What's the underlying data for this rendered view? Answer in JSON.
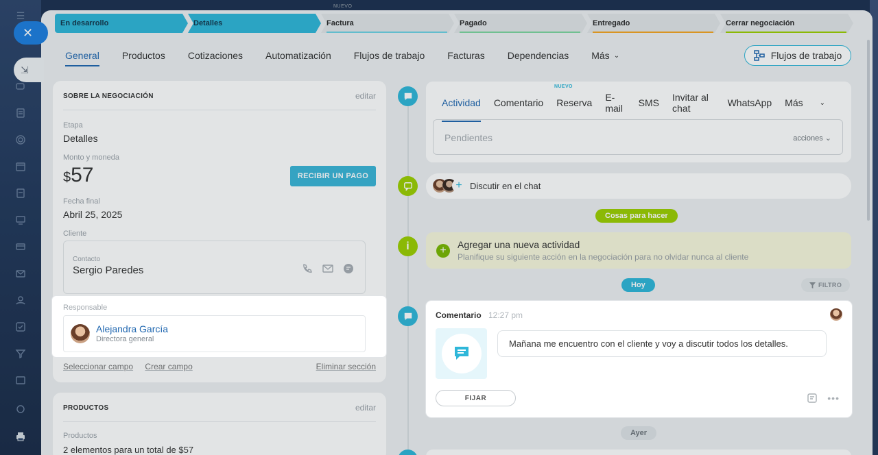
{
  "stages": [
    {
      "label": "En desarrollo",
      "state": "active",
      "color": "#2fb7d9"
    },
    {
      "label": "Detalles",
      "state": "active",
      "color": "#2fb7d9"
    },
    {
      "label": "Factura",
      "state": "pending",
      "color": "#6ed3e4"
    },
    {
      "label": "Pagado",
      "state": "pending",
      "color": "#7ed6a0"
    },
    {
      "label": "Entregado",
      "state": "pending",
      "color": "#f5a623"
    },
    {
      "label": "Cerrar negociación",
      "state": "pending",
      "color": "#9dcf00"
    }
  ],
  "stage_new_tag": "NUEVO",
  "tabs": [
    "General",
    "Productos",
    "Cotizaciones",
    "Automatización",
    "Flujos de trabajo",
    "Facturas",
    "Dependencias",
    "Más"
  ],
  "flows_button": "Flujos de trabajo",
  "about": {
    "title": "SOBRE LA NEGOCIACIÓN",
    "edit": "editar",
    "stage_label": "Etapa",
    "stage_value": "Detalles",
    "amount_label": "Monto y moneda",
    "currency": "$",
    "amount": "57",
    "pay_button": "RECIBIR UN PAGO",
    "date_label": "Fecha final",
    "date_value": "Abril 25, 2025",
    "client_label": "Cliente",
    "contact_label": "Contacto",
    "contact_name": "Sergio Paredes",
    "responsible_label": "Responsable",
    "responsible_name": "Alejandra García",
    "responsible_position": "Directora general",
    "link_select": "Seleccionar campo",
    "link_create": "Crear campo",
    "link_delete": "Eliminar sección"
  },
  "products": {
    "title": "PRODUCTOS",
    "edit": "editar",
    "label": "Productos",
    "value": "2 elementos para un total de $57"
  },
  "activity": {
    "tabs": [
      "Actividad",
      "Comentario",
      "Reserva",
      "E-mail",
      "SMS",
      "Invitar al chat",
      "WhatsApp",
      "Más"
    ],
    "new_tag": "NUEVO",
    "pending_placeholder": "Pendientes",
    "actions": "acciones"
  },
  "chat": {
    "label": "Discutir en el chat"
  },
  "todo_pill": "Cosas para hacer",
  "todo": {
    "title": "Agregar una nueva actividad",
    "subtitle": "Planifique su siguiente acción en la negociación para no olvidar nunca al cliente"
  },
  "today_pill": "Hoy",
  "filter": "FILTRO",
  "comment": {
    "header": "Comentario",
    "time": "12:27 pm",
    "text": "Mañana me encuentro con el cliente y voy a discutir todos los detalles.",
    "pin": "FIJAR"
  },
  "yesterday_pill": "Ayer",
  "colors": {
    "accent": "#2fb7d9",
    "link": "#2067b0",
    "green": "#9dcf00"
  }
}
